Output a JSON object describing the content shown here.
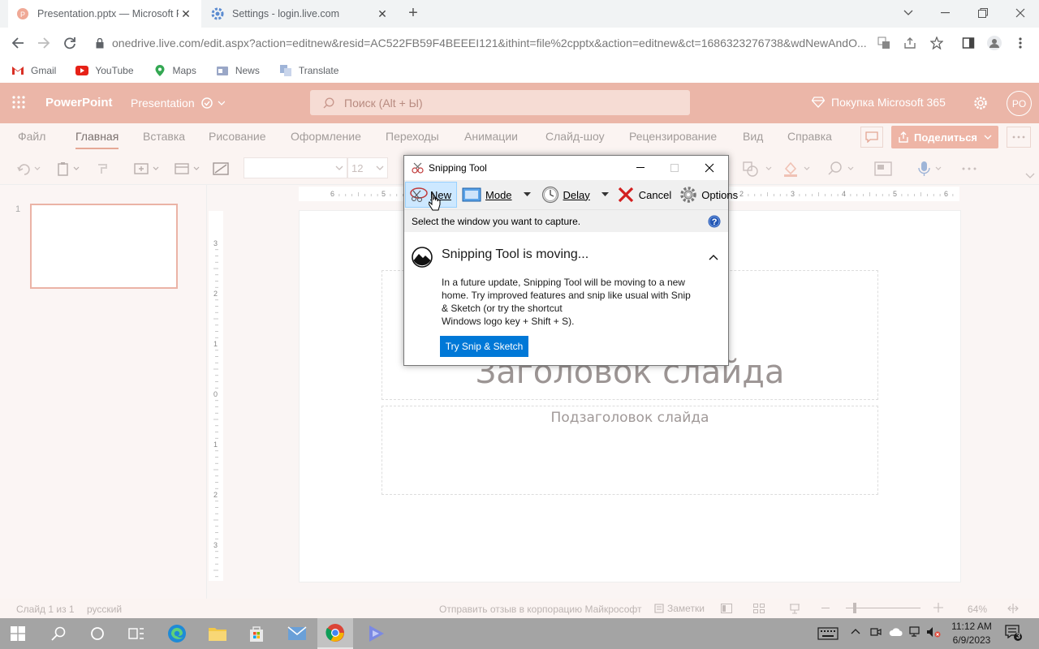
{
  "browser": {
    "tabs": [
      {
        "title": "Presentation.pptx — Microsoft P",
        "close": "✕"
      },
      {
        "title": "Settings - login.live.com",
        "close": "✕"
      }
    ],
    "new_tab": "+",
    "url": "onedrive.live.com/edit.aspx?action=editnew&resid=AC522FB59F4BEEEI121&ithint=file%2cpptx&action=editnew&ct=1686323276738&wdNewAndO...",
    "bookmarks": [
      "Gmail",
      "YouTube",
      "Maps",
      "News",
      "Translate"
    ]
  },
  "powerpoint": {
    "app_name": "PowerPoint",
    "doc_name": "Presentation",
    "search_placeholder": "Поиск (Alt + Ы)",
    "buy_label": "Покупка Microsoft 365",
    "avatar": "PO",
    "menu": [
      "Файл",
      "Главная",
      "Вставка",
      "Рисование",
      "Оформление",
      "Переходы",
      "Анимации",
      "Слайд-шоу",
      "Рецензирование",
      "Вид",
      "Справка"
    ],
    "share_label": "Поделиться",
    "font_size": "12",
    "slide_number": "1",
    "slide_title": "Заголовок слайда",
    "slide_subtitle": "Подзаголовок слайда",
    "ruler_numbers_h": [
      "6",
      "5",
      "4",
      "3",
      "2",
      "1",
      "0",
      "1",
      "2",
      "3",
      "4",
      "5",
      "6"
    ],
    "ruler_numbers_v": [
      "3",
      "2",
      "1",
      "0",
      "1",
      "2",
      "3"
    ],
    "status": {
      "slide_count": "Слайд 1 из 1",
      "language": "русский",
      "feedback": "Отправить отзыв в корпорацию Майкрософт",
      "notes": "Заметки",
      "zoom": "64%"
    }
  },
  "snipping_tool": {
    "title": "Snipping Tool",
    "buttons": {
      "new": "New",
      "mode": "Mode",
      "delay": "Delay",
      "cancel": "Cancel",
      "options": "Options"
    },
    "instruction": "Select the window you want to capture.",
    "notice_title": "Snipping Tool is moving...",
    "notice_lines": [
      "In a future update, Snipping Tool will be moving to a new",
      "home. Try improved features and snip like usual with Snip",
      "& Sketch (or try the shortcut",
      "Windows logo key + Shift + S)."
    ],
    "try_button": "Try Snip & Sketch"
  },
  "taskbar": {
    "time": "11:12 AM",
    "date": "6/9/2023",
    "notifications": "3"
  },
  "colors": {
    "accent": "#ebb6a8",
    "share_button": "#eeb5a6",
    "snip_button": "#0078d7",
    "taskbar": "#a4a4a4"
  }
}
